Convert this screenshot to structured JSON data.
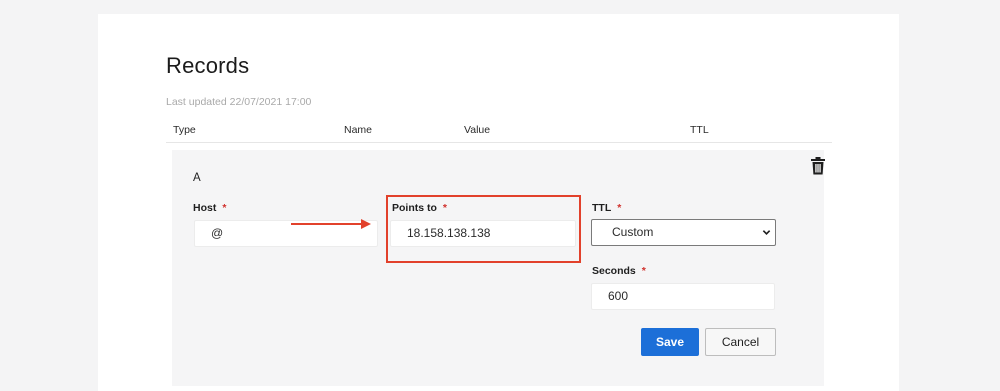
{
  "records": {
    "title": "Records",
    "last_updated": "Last updated 22/07/2021 17:00",
    "columns": [
      "Type",
      "Name",
      "Value",
      "TTL"
    ]
  },
  "record": {
    "type": "A",
    "host": {
      "label": "Host",
      "required_mark": "*",
      "value": "@"
    },
    "points_to": {
      "label": "Points to",
      "required_mark": "*",
      "value": "18.158.138.138"
    },
    "ttl": {
      "label": "TTL",
      "required_mark": "*",
      "selected": "Custom"
    },
    "seconds": {
      "label": "Seconds",
      "required_mark": "*",
      "value": "600"
    },
    "save_label": "Save",
    "cancel_label": "Cancel",
    "delete_icon": "trash-icon"
  },
  "colors": {
    "accent": "#1c6fd8",
    "required": "#d0312d",
    "annotation": "#e2412b"
  }
}
